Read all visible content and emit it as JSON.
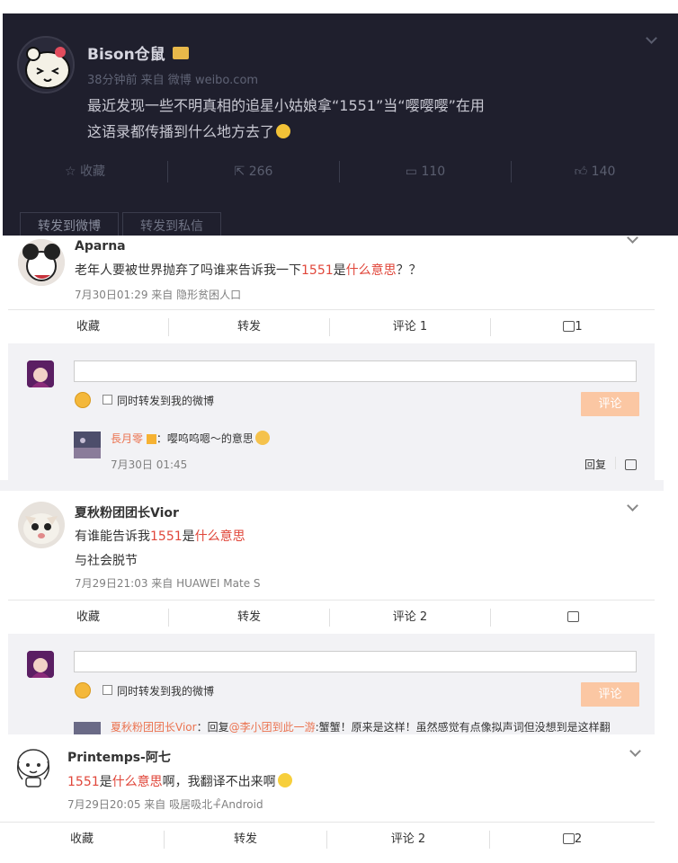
{
  "post": {
    "author": "Bison仓鼠",
    "meta": "38分钟前 来自 微博 weibo.com",
    "text_line1": "最近发现一些不明真相的追星小姑娘拿“1551”当“嘤嘤嘤”在用",
    "text_line2": "这语录都传播到什么地方去了",
    "actions": {
      "favorite": "收藏",
      "repost_count": "266",
      "comment_count": "110",
      "like_count": "140"
    },
    "tabs": [
      "转发到微博",
      "转发到私信"
    ]
  },
  "comments": [
    {
      "author": "Aparna",
      "text_a": "老年人要被世界抛弃了吗谁来告诉我一下",
      "text_b": "1551",
      "text_c": "是",
      "text_d": "什么意思",
      "text_e": "？？",
      "meta": "7月30日01:29 来自 隐形贫困人口",
      "actions": {
        "favorite": "收藏",
        "repost": "转发",
        "comment": "评论 1",
        "like": "1"
      },
      "reply_box": {
        "sync_label": "同时转发到我的微博",
        "submit": "评论"
      },
      "sub_reply": {
        "author": "長月零",
        "text": "：嘤呜呜嗯～的意思",
        "time": "7月30日 01:45",
        "reply": "回复"
      }
    },
    {
      "author": "夏秋粉团团长Vior",
      "text_a": "有谁能告诉我",
      "text_b": "1551",
      "text_c": "是",
      "text_d": "什么意思",
      "text_line2": "与社会脱节",
      "meta": "7月29日21:03 来自 HUAWEI Mate S",
      "actions": {
        "favorite": "收藏",
        "repost": "转发",
        "comment": "评论 2",
        "like": ""
      },
      "reply_box": {
        "sync_label": "同时转发到我的微博",
        "submit": "评论"
      },
      "sub_reply": {
        "author": "夏秋粉团团长Vior",
        "text_a": "：回复",
        "mention": "@李小团到此一游",
        "text_b": ":蟹蟹！原来是这样！虽然感觉有点像拟声词但没想到是这样翻"
      }
    },
    {
      "author": "Printemps-阿七",
      "text_b": "1551",
      "text_c": "是",
      "text_d": "什么意思",
      "text_e": "啊，我翻译不出来啊",
      "meta": "7月29日20:05 来自 吸居吸北+̊Android",
      "actions": {
        "favorite": "收藏",
        "repost": "转发",
        "comment": "评论 2",
        "like": "2"
      }
    }
  ]
}
